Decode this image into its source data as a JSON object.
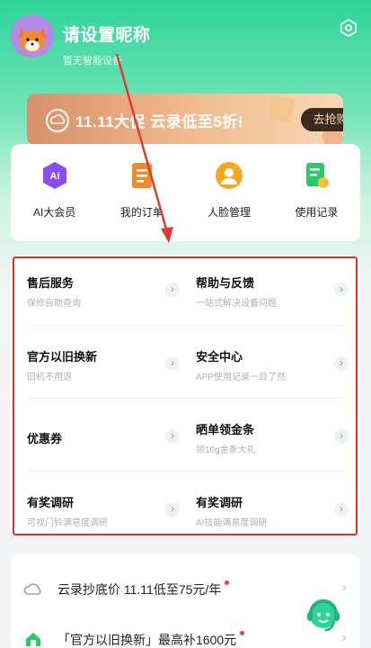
{
  "header": {
    "nickname": "请设置昵称",
    "device_status": "暂无智能设备",
    "settings_icon": "settings-hexagon-icon"
  },
  "banner": {
    "text": "11.11大促  云录低至5折!",
    "button": "去抢购",
    "icon": "cloud-icon"
  },
  "quick_actions": [
    {
      "label": "AI大会员",
      "icon": "ai-badge-icon",
      "color": "#8a4df0"
    },
    {
      "label": "我的订单",
      "icon": "order-list-icon",
      "color": "#f08a2a"
    },
    {
      "label": "人脸管理",
      "icon": "face-user-icon",
      "color": "#f5a623"
    },
    {
      "label": "使用记录",
      "icon": "usage-record-icon",
      "color": "#2ec76a"
    }
  ],
  "services": [
    {
      "title": "售后服务",
      "subtitle": "保修自助查询"
    },
    {
      "title": "帮助与反馈",
      "subtitle": "一站式解决设备问题"
    },
    {
      "title": "官方以旧换新",
      "subtitle": "旧机不用退"
    },
    {
      "title": "安全中心",
      "subtitle": "APP使用记录一目了然"
    },
    {
      "title": "优惠券",
      "subtitle": ""
    },
    {
      "title": "晒单领金条",
      "subtitle": "领10g金条大礼"
    },
    {
      "title": "有奖调研",
      "subtitle": "可视门铃满意度调研"
    },
    {
      "title": "有奖调研",
      "subtitle": "AI技能满意度调研"
    }
  ],
  "promo_list": [
    {
      "text": "云录抄底价 11.11低至75元/年",
      "icon": "cloud-outline-icon"
    },
    {
      "text": "「官方以旧换新」最高补1600元",
      "icon": "green-house-icon"
    }
  ],
  "floating": {
    "icon": "customer-service-headset-icon"
  },
  "colors": {
    "accent": "#2fd39a",
    "highlight_border": "#ea2b2b",
    "annotation_arrow": "#e23b2b"
  }
}
